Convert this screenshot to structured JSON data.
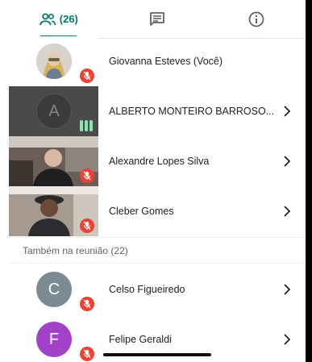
{
  "tabs": {
    "people_count": "(26)",
    "items": [
      "people",
      "chat",
      "info"
    ]
  },
  "participants": [
    {
      "name": "Giovanna Esteves (Você)",
      "muted": true
    },
    {
      "name": "ALBERTO MONTEIRO BARROSO...",
      "speaking": true,
      "initial": "A"
    },
    {
      "name": "Alexandre Lopes Silva",
      "muted": true
    },
    {
      "name": "Cleber Gomes",
      "muted": true
    }
  ],
  "also_in_meeting": {
    "label": "Também na reunião (22)",
    "people": [
      {
        "name": "Celso Figueiredo",
        "initial": "C",
        "color": "#7b8a93",
        "muted": true
      },
      {
        "name": "Felipe Geraldi",
        "initial": "F",
        "color": "#a142c9",
        "muted": true
      }
    ]
  },
  "colors": {
    "accent": "#00796b",
    "mute": "#ea4335",
    "speaking": "#8be5b0"
  }
}
